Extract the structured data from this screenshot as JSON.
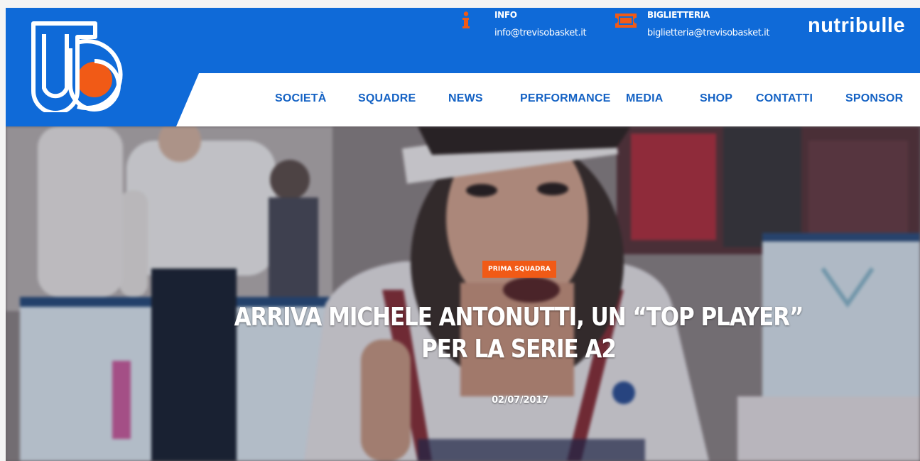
{
  "header": {
    "info": {
      "title": "INFO",
      "email": "info@trevisobasket.it"
    },
    "tickets": {
      "title": "BIGLIETTERIA",
      "email": "biglietteria@trevisobasket.it"
    },
    "sponsor_logo": "nutribulle"
  },
  "nav": {
    "items": [
      {
        "label": "SOCIETÀ"
      },
      {
        "label": "SQUADRE"
      },
      {
        "label": "NEWS"
      },
      {
        "label": "PERFORMANCE"
      },
      {
        "label": "MEDIA"
      },
      {
        "label": "SHOP"
      },
      {
        "label": "CONTATTI"
      },
      {
        "label": "SPONSOR"
      }
    ]
  },
  "hero": {
    "category": "PRIMA SQUADRA",
    "title_line1": "ARRIVA MICHELE ANTONUTTI, UN “TOP PLAYER”",
    "title_line2": "PER LA SERIE A2",
    "date": "02/07/2017"
  },
  "colors": {
    "brand_blue": "#0f6ad8",
    "nav_text": "#1462c4",
    "accent_orange": "#f15a16"
  },
  "icons": {
    "info": "info-icon",
    "tickets": "ticket-icon",
    "logo": "treviso-basket-logo"
  }
}
